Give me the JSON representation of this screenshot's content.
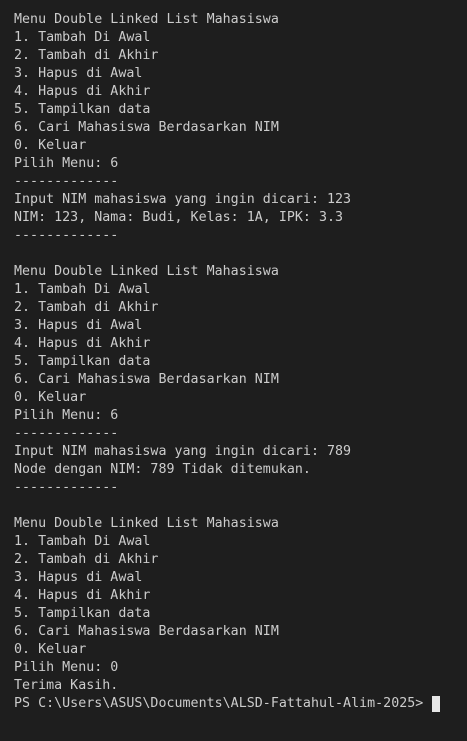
{
  "terminal": {
    "lines": [
      "Menu Double Linked List Mahasiswa",
      "1. Tambah Di Awal",
      "2. Tambah di Akhir",
      "3. Hapus di Awal",
      "4. Hapus di Akhir",
      "5. Tampilkan data",
      "6. Cari Mahasiswa Berdasarkan NIM",
      "0. Keluar",
      "Pilih Menu: 6",
      "-------------",
      "Input NIM mahasiswa yang ingin dicari: 123",
      "NIM: 123, Nama: Budi, Kelas: 1A, IPK: 3.3",
      "-------------",
      "",
      "Menu Double Linked List Mahasiswa",
      "1. Tambah Di Awal",
      "2. Tambah di Akhir",
      "3. Hapus di Awal",
      "4. Hapus di Akhir",
      "5. Tampilkan data",
      "6. Cari Mahasiswa Berdasarkan NIM",
      "0. Keluar",
      "Pilih Menu: 6",
      "-------------",
      "Input NIM mahasiswa yang ingin dicari: 789",
      "Node dengan NIM: 789 Tidak ditemukan.",
      "-------------",
      "",
      "Menu Double Linked List Mahasiswa",
      "1. Tambah Di Awal",
      "2. Tambah di Akhir",
      "3. Hapus di Awal",
      "4. Hapus di Akhir",
      "5. Tampilkan data",
      "6. Cari Mahasiswa Berdasarkan NIM",
      "0. Keluar",
      "Pilih Menu: 0",
      "Terima Kasih."
    ],
    "prompt": "PS C:\\Users\\ASUS\\Documents\\ALSD-Fattahul-Alim-2025> ",
    "colors": {
      "background": "#1e1e1e",
      "text": "#cccccc",
      "cursor": "#e6e6e6"
    }
  }
}
